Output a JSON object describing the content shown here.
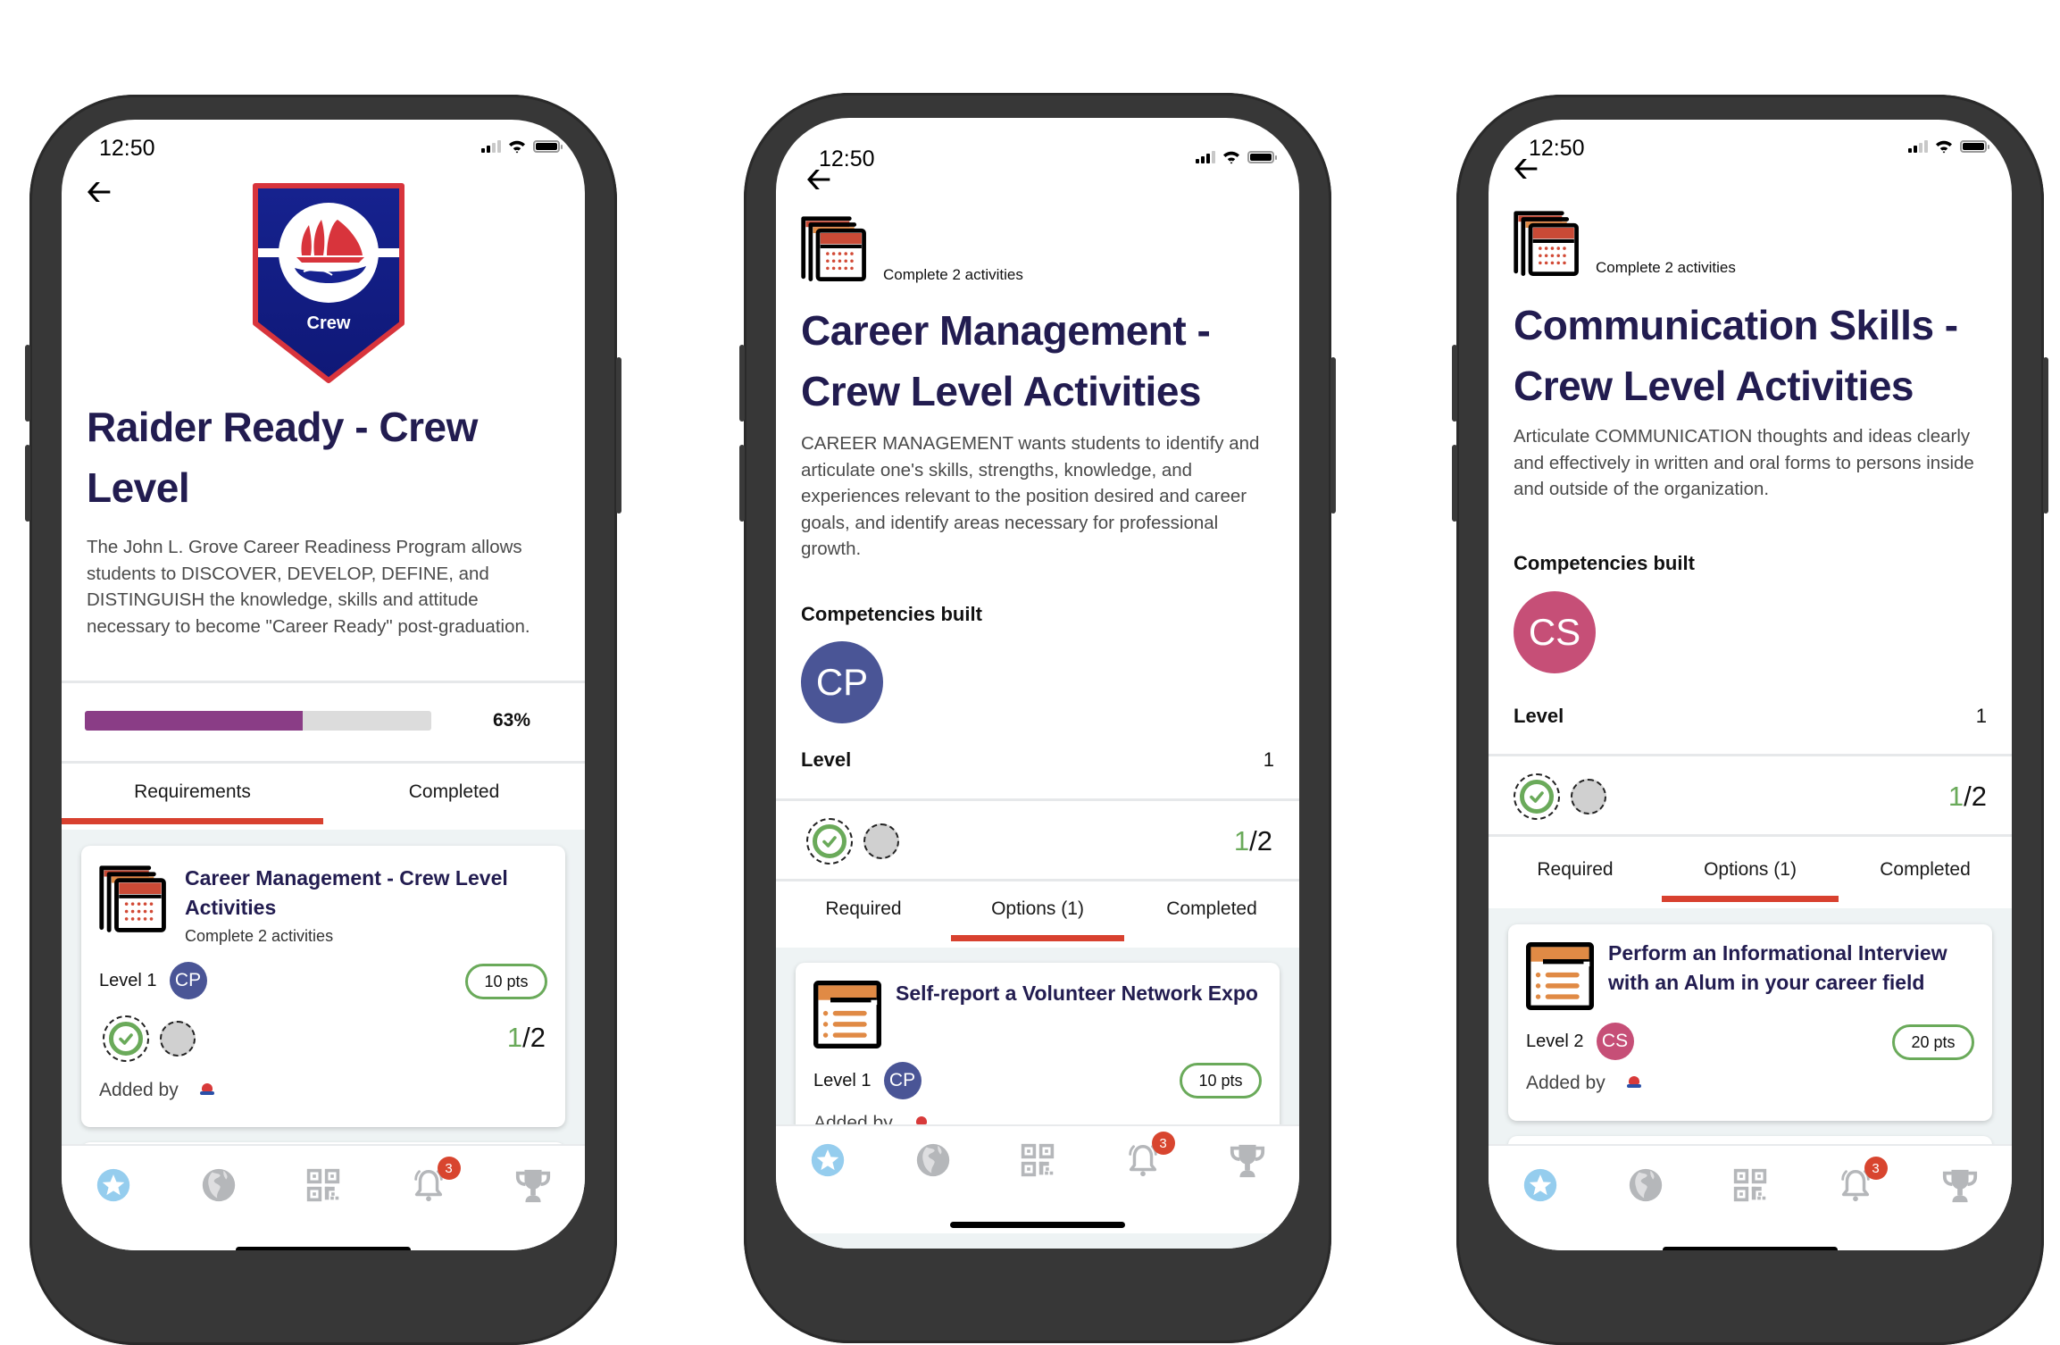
{
  "status_bar": {
    "time": "12:50"
  },
  "colors": {
    "title": "#221c50",
    "accent_red": "#d8412f",
    "progress_purple": "#8a3d86",
    "success_green": "#6aaa5a",
    "cp_avatar": "#4a5596",
    "cs_avatar": "#c64f77",
    "tab_active_icon": "#95cdee",
    "tab_icon": "#b5b7ba"
  },
  "tab_bar": {
    "items": [
      {
        "icon": "star-icon",
        "active": true
      },
      {
        "icon": "globe-icon",
        "active": false
      },
      {
        "icon": "qr-code-icon",
        "active": false
      },
      {
        "icon": "bell-icon",
        "active": false,
        "badge": "3"
      },
      {
        "icon": "trophy-icon",
        "active": false
      }
    ]
  },
  "screens": [
    {
      "badge_label": "Crew",
      "title": "Raider Ready - Crew Level",
      "description": "The John L. Grove Career Readiness Program allows students to DISCOVER, DEVELOP, DEFINE, and DISTINGUISH the knowledge, skills and attitude necessary to become \"Career Ready\" post-graduation.",
      "progress": {
        "percent": 63,
        "label": "63%"
      },
      "tabs": [
        {
          "label": "Requirements",
          "active": true
        },
        {
          "label": "Completed",
          "active": false
        }
      ],
      "card": {
        "title": "Career Management - Crew Level Activities",
        "subtitle": "Complete 2 activities",
        "level": "Level 1",
        "competency": "CP",
        "points": "10 pts",
        "done": "1",
        "total": "/2",
        "added_by": "Added by"
      }
    },
    {
      "header_sub": "Complete 2 activities",
      "title": "Career Management - Crew Level Activities",
      "description": "CAREER MANAGEMENT wants students to identify and articulate one's skills, strengths, knowledge, and experiences relevant to the position desired and career goals, and identify areas necessary for professional growth.",
      "competencies_label": "Competencies built",
      "competency": "CP",
      "level_label": "Level",
      "level_value": "1",
      "done": "1",
      "total": "/2",
      "tabs": [
        {
          "label": "Required",
          "active": false
        },
        {
          "label": "Options (1)",
          "active": true
        },
        {
          "label": "Completed",
          "active": false
        }
      ],
      "card": {
        "title": "Self-report a Volunteer Network Expo",
        "level": "Level 1",
        "competency": "CP",
        "points": "10 pts",
        "added_by": "Added by"
      }
    },
    {
      "header_sub": "Complete 2 activities",
      "title": "Communication Skills - Crew Level Activities",
      "description": "Articulate COMMUNICATION thoughts and ideas clearly and effectively in written and oral forms to persons inside and outside of the organization.",
      "competencies_label": "Competencies built",
      "competency": "CS",
      "level_label": "Level",
      "level_value": "1",
      "done": "1",
      "total": "/2",
      "tabs": [
        {
          "label": "Required",
          "active": false
        },
        {
          "label": "Options (1)",
          "active": true
        },
        {
          "label": "Completed",
          "active": false
        }
      ],
      "card": {
        "title": "Perform an Informational Interview with an Alum in your career field",
        "level": "Level 2",
        "competency": "CS",
        "points": "20 pts",
        "added_by": "Added by"
      }
    }
  ]
}
